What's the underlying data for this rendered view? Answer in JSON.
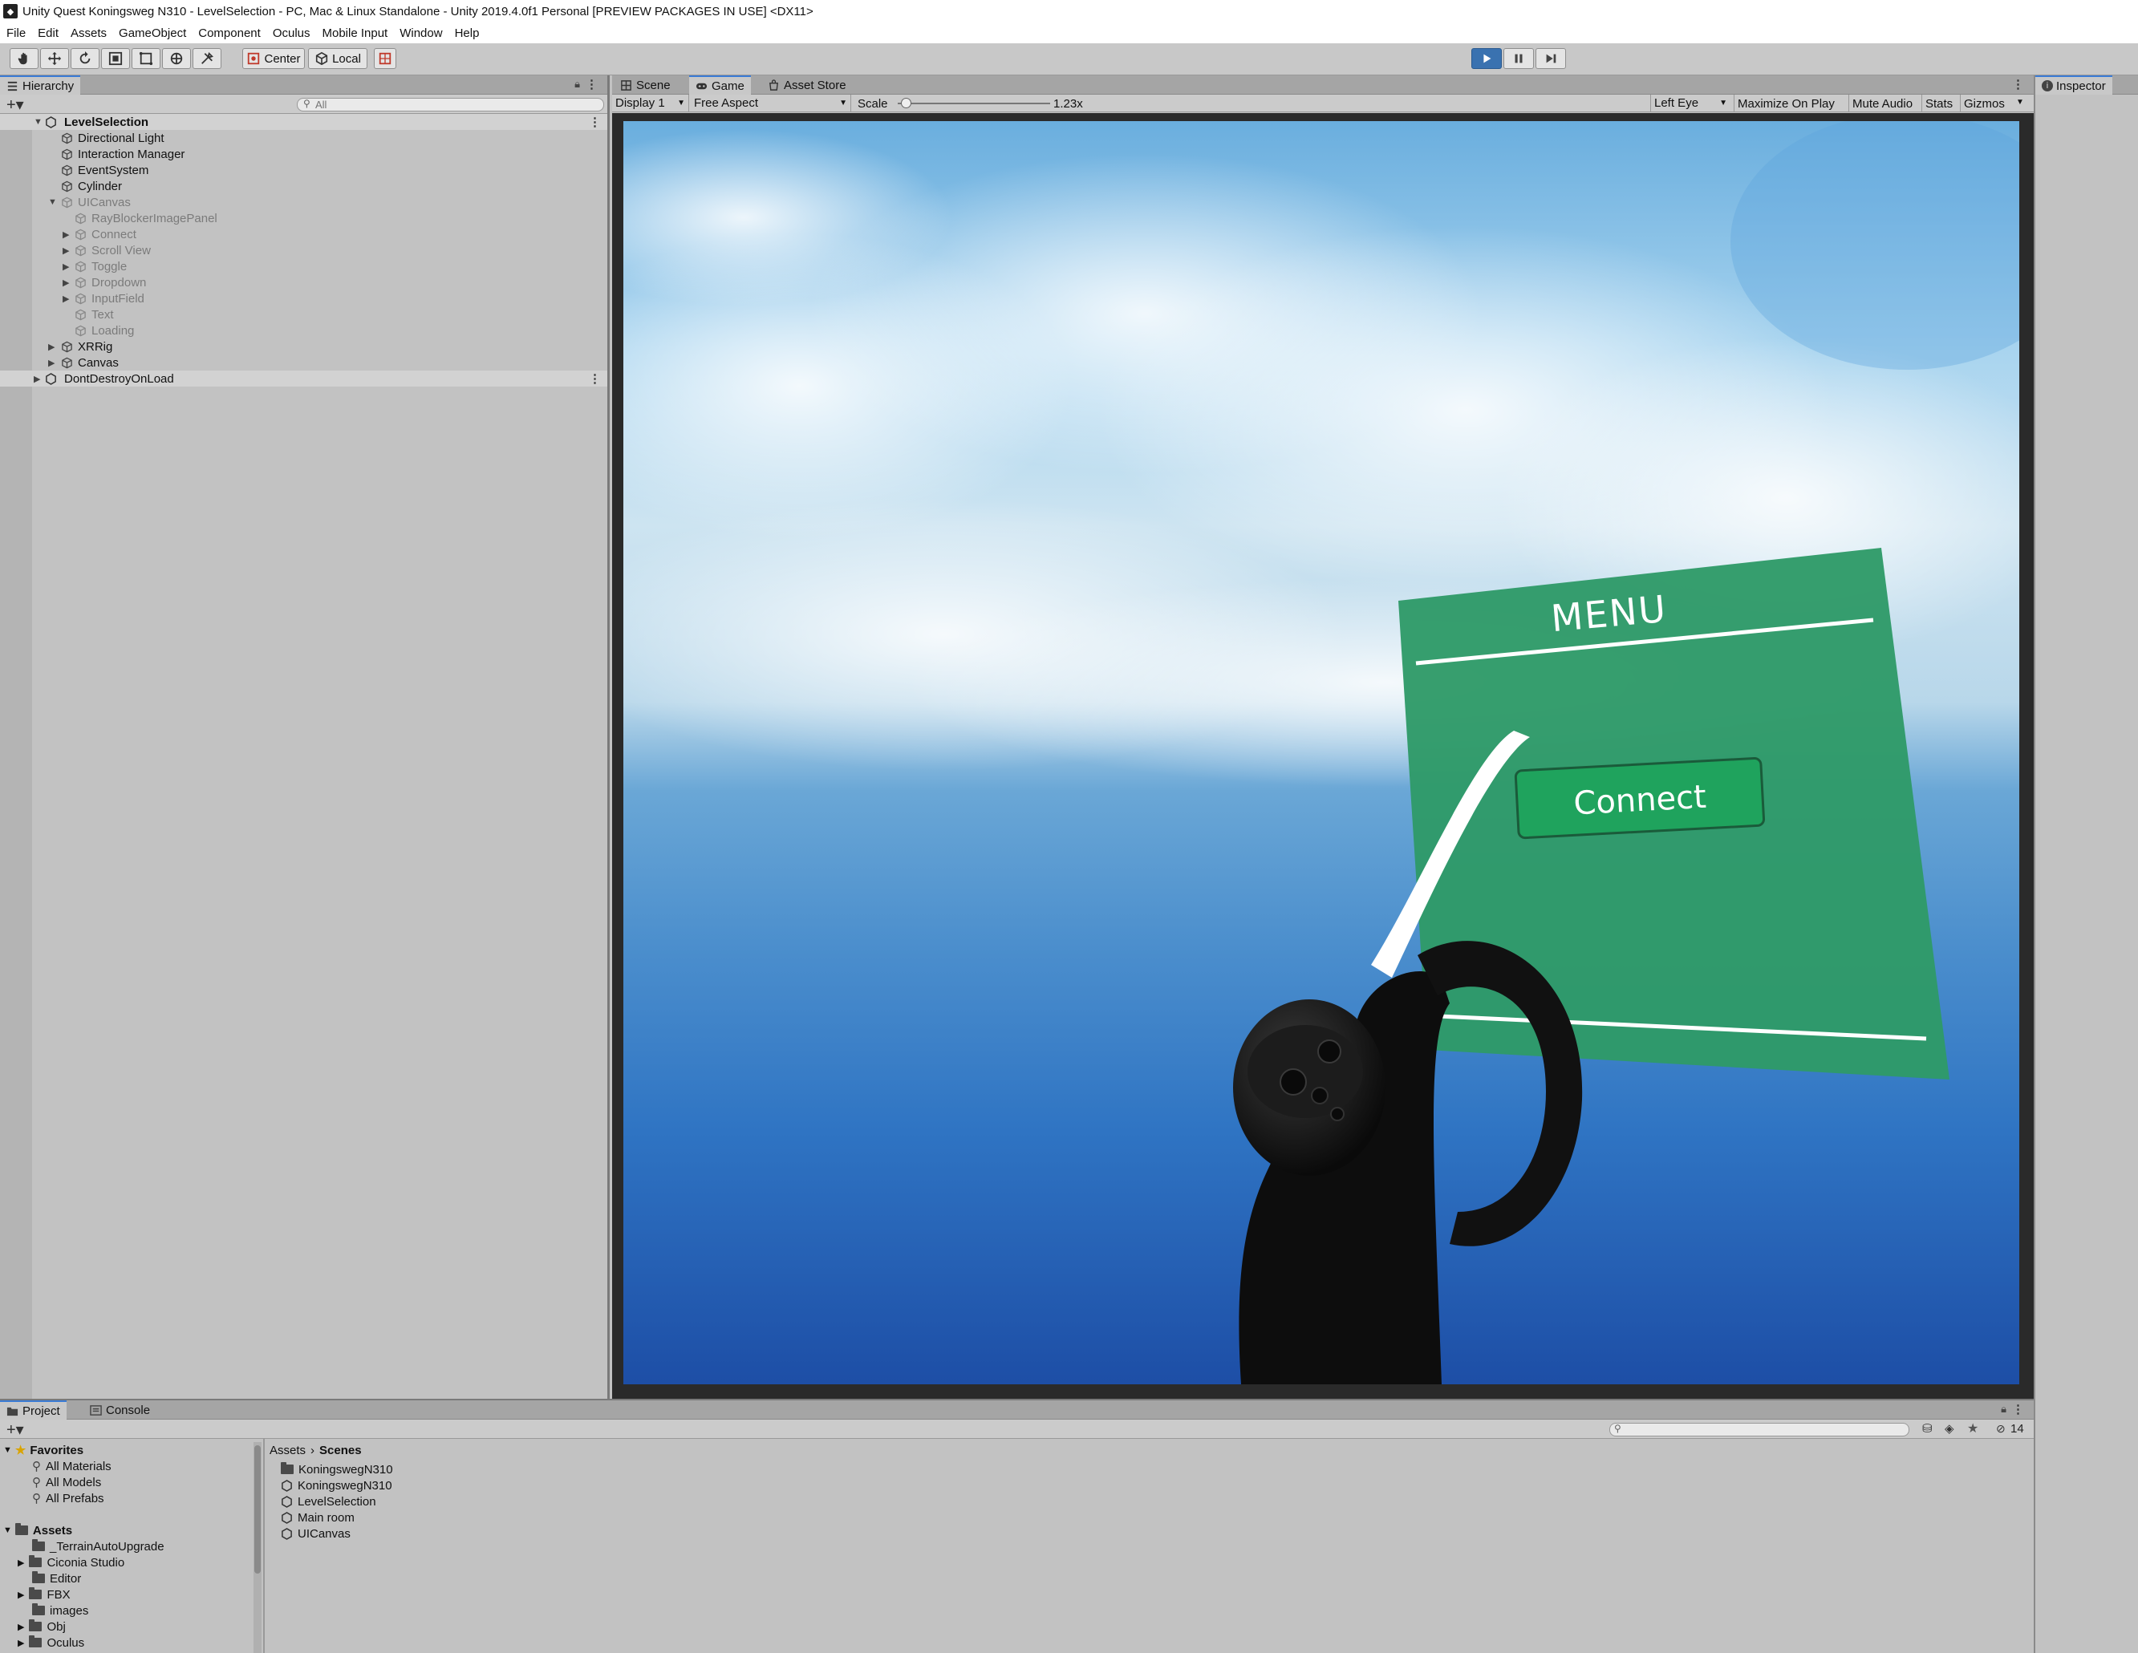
{
  "window": {
    "title": "Unity Quest Koningsweg N310 - LevelSelection - PC, Mac & Linux Standalone - Unity 2019.4.0f1 Personal [PREVIEW PACKAGES IN USE] <DX11>"
  },
  "menu": [
    "File",
    "Edit",
    "Assets",
    "GameObject",
    "Component",
    "Oculus",
    "Mobile Input",
    "Window",
    "Help"
  ],
  "toolbar": {
    "pivot_label": "Center",
    "space_label": "Local"
  },
  "hierarchy": {
    "tab_label": "Hierarchy",
    "search_placeholder": "All",
    "scene": "LevelSelection",
    "items": [
      "Directional Light",
      "Interaction Manager",
      "EventSystem",
      "Cylinder",
      "UICanvas",
      "RayBlockerImagePanel",
      "Connect",
      "Scroll View",
      "Toggle",
      "Dropdown",
      "InputField",
      "Text",
      "Loading",
      "XRRig",
      "Canvas"
    ],
    "dont_destroy": "DontDestroyOnLoad"
  },
  "game": {
    "tabs": [
      "Scene",
      "Game",
      "Asset Store"
    ],
    "display": "Display 1",
    "aspect": "Free Aspect",
    "scale_label": "Scale",
    "scale_value": "1.23x",
    "scale_fraction": 0.05,
    "eye": "Left Eye",
    "options": [
      "Maximize On Play",
      "Mute Audio",
      "Stats",
      "Gizmos"
    ],
    "menu_title": "MENU",
    "connect_label": "Connect"
  },
  "inspector": {
    "tab_label": "Inspector"
  },
  "project": {
    "tabs": [
      "Project",
      "Console"
    ],
    "favorites_label": "Favorites",
    "favorites": [
      "All Materials",
      "All Models",
      "All Prefabs"
    ],
    "assets_label": "Assets",
    "asset_folders": [
      "_TerrainAutoUpgrade",
      "Ciconia Studio",
      "Editor",
      "FBX",
      "images",
      "Obj",
      "Oculus"
    ],
    "breadcrumb": [
      "Assets",
      "Scenes"
    ],
    "files": [
      "KoningswegN310",
      "KoningswegN310",
      "LevelSelection",
      "Main room",
      "UICanvas"
    ],
    "hidden_count": "14"
  },
  "colors": {
    "menu_panel": "#2f9a68",
    "connect_button": "#1fa35d",
    "play_active": "#3a72b0"
  }
}
